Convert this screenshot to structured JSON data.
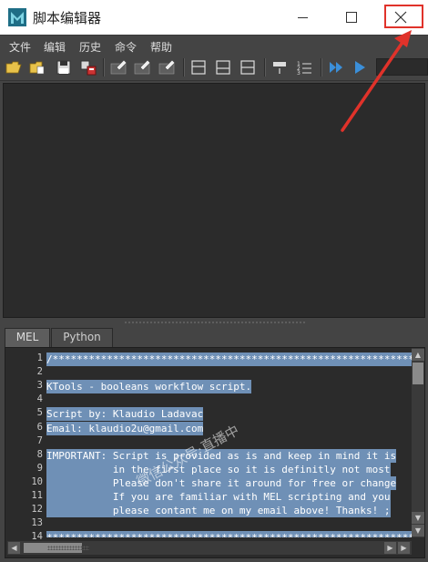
{
  "window": {
    "title": "脚本编辑器",
    "icon": "maya-app-icon",
    "controls": [
      "minimize-icon",
      "maximize-icon",
      "close-icon"
    ]
  },
  "menubar": {
    "items": [
      {
        "label": "文件"
      },
      {
        "label": "编辑"
      },
      {
        "label": "历史"
      },
      {
        "label": "命令"
      },
      {
        "label": "帮助"
      }
    ]
  },
  "toolbar": {
    "icons": [
      "open-script-icon",
      "source-script-icon",
      "save-script-icon",
      "save-to-shelf-icon",
      "clear-history-icon",
      "clear-input-icon",
      "clear-all-icon",
      "show-history-only-icon",
      "show-input-only-icon",
      "show-both-icon",
      "echo-all-commands-icon",
      "show-line-numbers-icon",
      "execute-all-icon",
      "execute-icon"
    ]
  },
  "tabs": [
    {
      "label": "MEL",
      "active": true
    },
    {
      "label": "Python",
      "active": false
    }
  ],
  "editor": {
    "lines": [
      {
        "number": "1",
        "text": "/*****************************************************************"
      },
      {
        "number": "2",
        "text": ""
      },
      {
        "number": "3",
        "text": "KTools - booleans workflow script."
      },
      {
        "number": "4",
        "text": ""
      },
      {
        "number": "5",
        "text": "Script by: Klaudio Ladavac"
      },
      {
        "number": "6",
        "text": "Email: klaudio2u@gmail.com"
      },
      {
        "number": "7",
        "text": ""
      },
      {
        "number": "8",
        "text": "IMPORTANT: Script is provided as is and keep in mind it is"
      },
      {
        "number": "9",
        "text": "           in the first place so it is definitly not most"
      },
      {
        "number": "10",
        "text": "           Please don't share it around for free or change"
      },
      {
        "number": "11",
        "text": "           If you are familiar with MEL scripting and you"
      },
      {
        "number": "12",
        "text": "           please contant me on my email above! Thanks! ;"
      },
      {
        "number": "13",
        "text": ""
      },
      {
        "number": "14",
        "text": "*****************************************************************"
      }
    ]
  },
  "watermark": "微信公众号·直播中",
  "colors": {
    "panel_bg": "#444444",
    "editor_bg": "#2b2b2b",
    "selection": "#6f90b6",
    "annotation_red": "#e0322a"
  }
}
